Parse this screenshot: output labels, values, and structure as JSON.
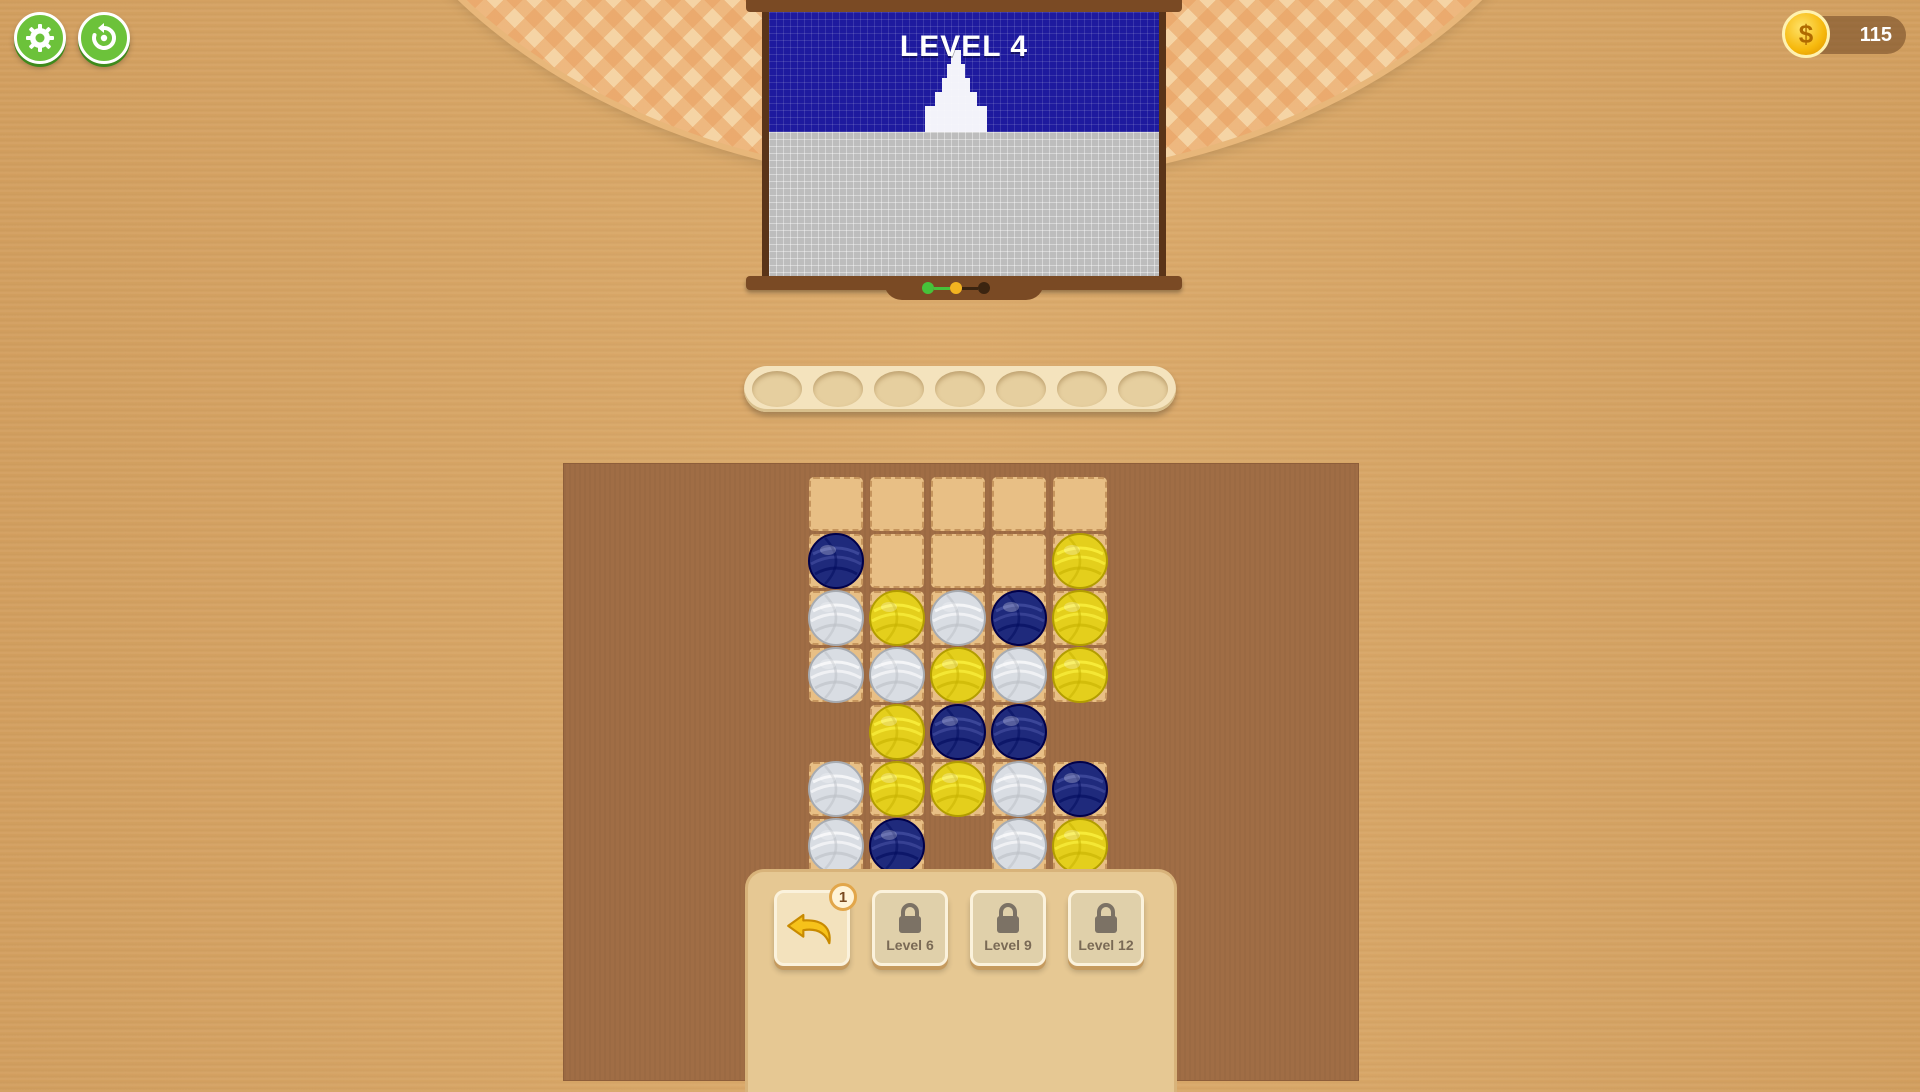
{
  "header": {
    "settings_icon": "gear-icon",
    "restart_icon": "restart-icon"
  },
  "coins": {
    "icon": "dollar-coin-icon",
    "symbol": "$",
    "value": "115"
  },
  "painting": {
    "level_title": "LEVEL 4",
    "sky_color": "#1e1a9e",
    "ground_color": "#bdbdbd",
    "progress": [
      "complete",
      "current",
      "pending"
    ]
  },
  "tray": {
    "slot_count": 7
  },
  "board": {
    "colors": {
      "blue": "#1f2a7c",
      "yellow": "#e4cf1c",
      "white": "#d9dde3"
    },
    "columns": 5,
    "rows": [
      [
        "empty-cell",
        "empty-cell",
        "empty-cell",
        "empty-cell",
        "empty-cell"
      ],
      [
        "blue",
        "empty-cell",
        "empty-cell",
        "empty-cell",
        "yellow"
      ],
      [
        "white",
        "yellow",
        "white",
        "blue",
        "yellow"
      ],
      [
        "white",
        "white",
        "yellow",
        "white",
        "yellow"
      ],
      [
        "none",
        "yellow",
        "blue",
        "blue",
        "none"
      ],
      [
        "white",
        "yellow",
        "yellow",
        "white",
        "blue"
      ],
      [
        "white",
        "blue",
        "none",
        "white",
        "yellow"
      ]
    ]
  },
  "boosters": [
    {
      "name": "undo",
      "icon": "undo-arrow-icon",
      "count": "1"
    },
    {
      "name": "locked",
      "icon": "lock-icon",
      "label": "Level 6"
    },
    {
      "name": "locked",
      "icon": "lock-icon",
      "label": "Level 9"
    },
    {
      "name": "locked",
      "icon": "lock-icon",
      "label": "Level 12"
    }
  ]
}
